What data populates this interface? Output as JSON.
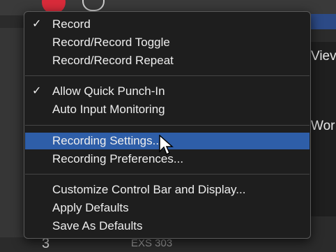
{
  "background": {
    "right_label_1": "Viev",
    "right_label_2": "Wor",
    "bottom_number": "3",
    "bottom_text": "EXS 303"
  },
  "menu": {
    "items": [
      {
        "label": "Record",
        "checked": true
      },
      {
        "label": "Record/Record Toggle",
        "checked": false
      },
      {
        "label": "Record/Record Repeat",
        "checked": false
      },
      {
        "label": "Allow Quick Punch-In",
        "checked": true
      },
      {
        "label": "Auto Input Monitoring",
        "checked": false
      },
      {
        "label": "Recording Settings...",
        "checked": false,
        "highlighted": true
      },
      {
        "label": "Recording Preferences...",
        "checked": false
      },
      {
        "label": "Customize Control Bar and Display...",
        "checked": false
      },
      {
        "label": "Apply Defaults",
        "checked": false
      },
      {
        "label": "Save As Defaults",
        "checked": false
      }
    ],
    "check_glyph": "✓",
    "highlight_color": "#2e5ea8"
  }
}
